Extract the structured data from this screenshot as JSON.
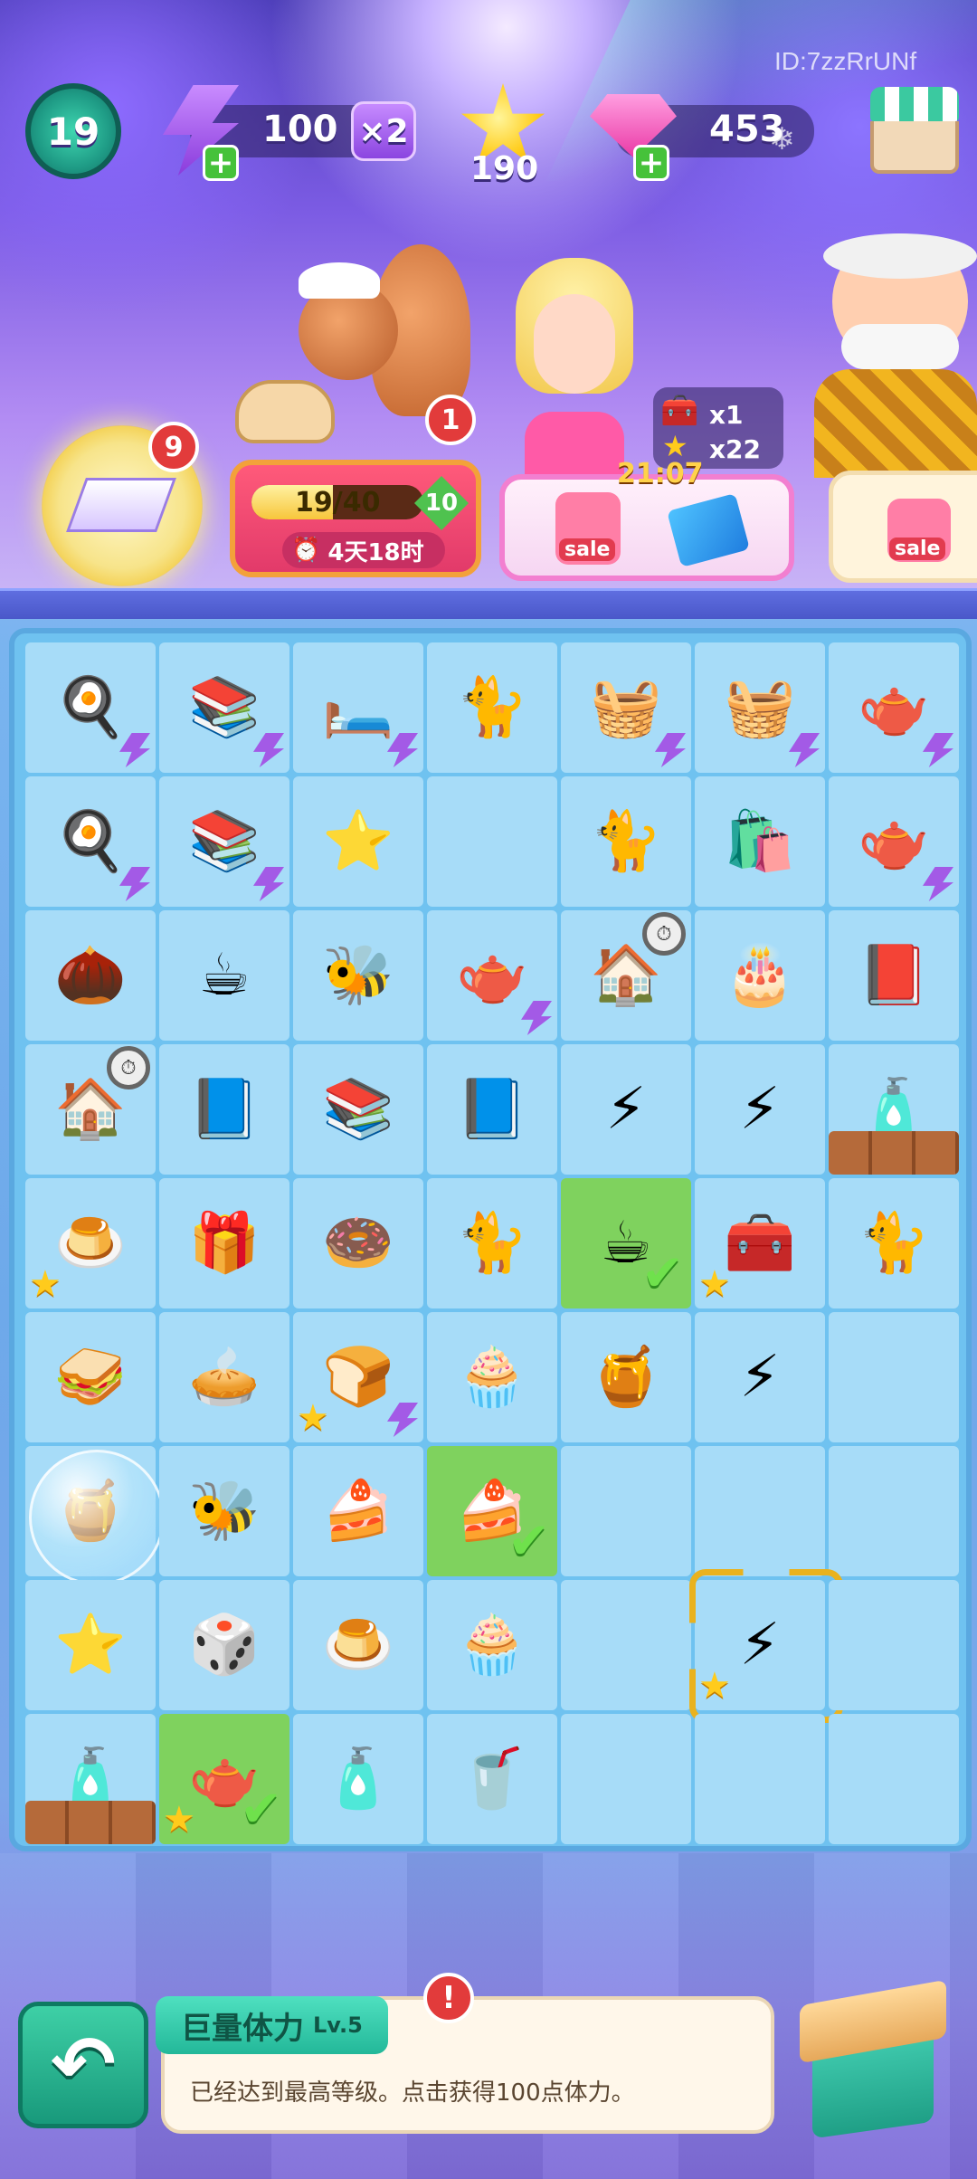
{
  "player_id": "ID:7zzRrUNf",
  "hud": {
    "level": "19",
    "energy": "100",
    "energy_multiplier": "×2",
    "stars": "190",
    "gems": "453"
  },
  "event": {
    "badge_count": "9",
    "order_count": "1",
    "progress": "19/40",
    "progress_fraction": 0.475,
    "reward_value": "10",
    "timer": "4天18时"
  },
  "offer": {
    "countdown": "21:07",
    "bonus_chest": "x1",
    "bonus_stars": "x22",
    "sale_label": "sale",
    "sale_label_2": "sale"
  },
  "board": {
    "rows": [
      [
        {
          "icon": "🍳",
          "bolt": true
        },
        {
          "icon": "📚",
          "bolt": true
        },
        {
          "icon": "🛏️",
          "bolt": true
        },
        {
          "icon": "🐈"
        },
        {
          "icon": "🧺",
          "bolt": true
        },
        {
          "icon": "🧺",
          "bolt": true
        },
        {
          "icon": "🫖",
          "bolt": true
        }
      ],
      [
        {
          "icon": "🍳",
          "bolt": true
        },
        {
          "icon": "📚",
          "bolt": true
        },
        {
          "icon": "⭐"
        },
        {
          "icon": ""
        },
        {
          "icon": "🐈"
        },
        {
          "icon": "🛍️"
        },
        {
          "icon": "🫖",
          "bolt": true
        }
      ],
      [
        {
          "icon": "🌰"
        },
        {
          "icon": "☕"
        },
        {
          "icon": "🐝"
        },
        {
          "icon": "🫖",
          "bolt": true
        },
        {
          "icon": "🏠",
          "clock": true
        },
        {
          "icon": "🎂"
        },
        {
          "icon": "📕"
        }
      ],
      [
        {
          "icon": "🏠",
          "clock": true
        },
        {
          "icon": "📘"
        },
        {
          "icon": "📚"
        },
        {
          "icon": "📘"
        },
        {
          "icon": "⚡"
        },
        {
          "icon": "⚡"
        },
        {
          "icon": "🧴",
          "web": true
        }
      ],
      [
        {
          "icon": "🍮",
          "star": true
        },
        {
          "icon": "🎁"
        },
        {
          "icon": "🍩"
        },
        {
          "icon": "🐈"
        },
        {
          "icon": "☕",
          "check": true,
          "hl": true
        },
        {
          "icon": "🧰",
          "star": true
        },
        {
          "icon": "🐈"
        }
      ],
      [
        {
          "icon": "🥪"
        },
        {
          "icon": "🥧"
        },
        {
          "icon": "🍞",
          "star": true,
          "bolt": true
        },
        {
          "icon": "🧁"
        },
        {
          "icon": "🍯"
        },
        {
          "icon": "⚡"
        },
        {
          "icon": ""
        }
      ],
      [
        {
          "icon": "🍯",
          "bubble": true
        },
        {
          "icon": "🐝"
        },
        {
          "icon": "🍰"
        },
        {
          "icon": "🍰",
          "check": true,
          "hl": true
        },
        {
          "icon": ""
        },
        {
          "icon": ""
        },
        {
          "icon": ""
        }
      ],
      [
        {
          "icon": "⭐"
        },
        {
          "icon": "🎲"
        },
        {
          "icon": "🍮"
        },
        {
          "icon": "🧁"
        },
        {
          "icon": ""
        },
        {
          "icon": "⚡",
          "star": true,
          "selected": true
        },
        {
          "icon": ""
        }
      ],
      [
        {
          "icon": "🧴",
          "web": true
        },
        {
          "icon": "🫖",
          "star": true,
          "check": true,
          "hl": true
        },
        {
          "icon": "🧴"
        },
        {
          "icon": "🥤"
        },
        {
          "icon": ""
        },
        {
          "icon": ""
        },
        {
          "icon": ""
        }
      ]
    ]
  },
  "info_panel": {
    "title": "巨量体力",
    "level": "Lv.5",
    "description": "已经达到最高等级。点击获得100点体力。",
    "alert": "!"
  }
}
